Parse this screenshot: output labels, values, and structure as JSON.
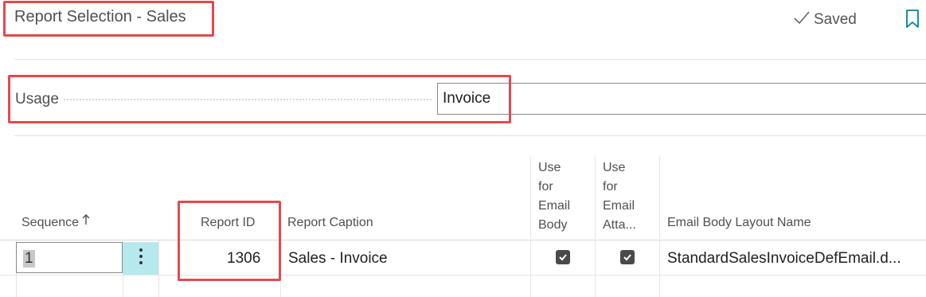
{
  "header": {
    "title": "Report Selection - Sales",
    "saved_label": "Saved"
  },
  "usage": {
    "label": "Usage",
    "value": "Invoice"
  },
  "table": {
    "columns": {
      "sequence": "Sequence",
      "report_id": "Report ID",
      "report_caption": "Report Caption",
      "email_body": [
        "Use",
        "for",
        "Email",
        "Body"
      ],
      "email_attachment": [
        "Use",
        "for",
        "Email",
        "Atta..."
      ],
      "email_body_layout": "Email Body Layout Name"
    },
    "rows": [
      {
        "sequence": "1",
        "report_id": "1306",
        "report_caption": "Sales - Invoice",
        "use_for_email_body": true,
        "use_for_email_attachment": true,
        "email_body_layout_name": "StandardSalesInvoiceDefEmail.d..."
      }
    ]
  },
  "icons": {
    "saved": "checkmark-icon",
    "bookmark": "bookmark-icon",
    "sort": "sort-ascending-icon",
    "row_menu": "more-vertical-icon"
  },
  "colors": {
    "highlight": "#e5484d",
    "accent": "#00838f",
    "row_action_bg": "#b6e9ee"
  }
}
